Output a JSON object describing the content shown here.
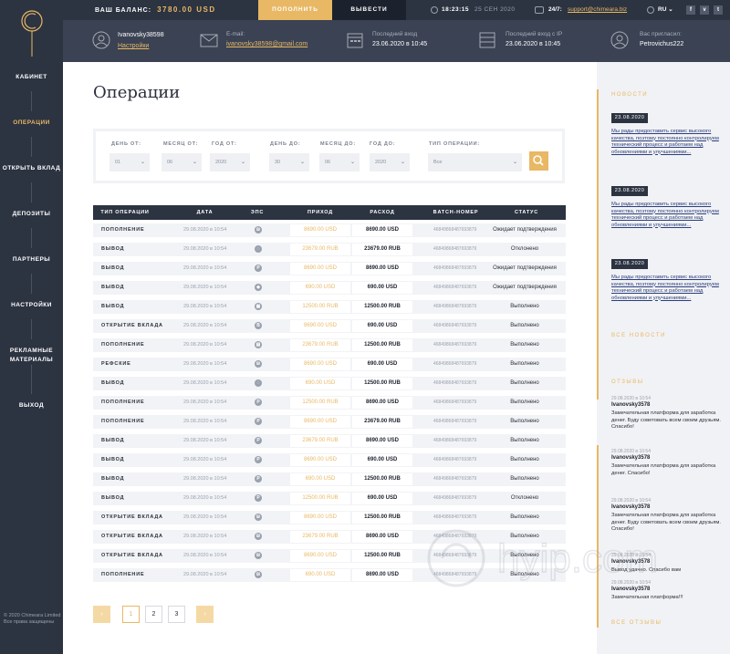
{
  "topbar": {
    "balance_label": "ВАШ БАЛАНС:",
    "balance_value": "3780.00 USD",
    "deposit_label": "ПОПОЛНИТЬ",
    "withdraw_label": "ВЫВЕСТИ",
    "time": "18:23:15",
    "date": "25 СЕН 2020",
    "support_label": "24/7:",
    "support_email": "support@chimeara.biz",
    "lang": "RU ⌄",
    "social": [
      "f",
      "v",
      "t"
    ]
  },
  "info": {
    "username": "Ivanovsky38598",
    "settings_link": "Настройки",
    "email_label": "E-mail:",
    "email_value": "ivanovsky38598@gmail.com",
    "last_login_label": "Последний вход",
    "last_login_value": "23.06.2020 в 10:45",
    "last_ip_label": "Последний вход с IP",
    "last_ip_value": "23.06.2020 в 10:45",
    "invited_label": "Вас пригласил:",
    "invited_value": "Petrovichus222"
  },
  "sidebar": {
    "items": [
      {
        "label": "КАБИНЕТ"
      },
      {
        "label": "ОПЕРАЦИИ"
      },
      {
        "label": "ОТКРЫТЬ ВКЛАД"
      },
      {
        "label": "ДЕПОЗИТЫ"
      },
      {
        "label": "ПАРТНЕРЫ"
      },
      {
        "label": "НАСТРОЙКИ"
      },
      {
        "label": "РЕКЛАМНЫЕ МАТЕРИАЛЫ"
      },
      {
        "label": "ВЫХОД"
      }
    ],
    "copyright_1": "© 2020 Chimeara Limited",
    "copyright_2": "Все права защищены"
  },
  "main": {
    "title": "Операции",
    "filters": {
      "day_from_label": "ДЕНЬ ОТ:",
      "day_from": "01",
      "month_from_label": "МЕСЯЦ ОТ:",
      "month_from": "06",
      "year_from_label": "ГОД ОТ:",
      "year_from": "2020",
      "day_to_label": "ДЕНЬ ДО:",
      "day_to": "30",
      "month_to_label": "МЕСЯЦ ДО:",
      "month_to": "06",
      "year_to_label": "ГОД ДО:",
      "year_to": "2020",
      "type_label": "ТИП ОПЕРАЦИИ:",
      "type": "Все"
    },
    "table": {
      "headers": [
        "ТИП ОПЕРАЦИИ",
        "ДАТА",
        "ЭПС",
        "ПРИХОД",
        "РАСХОД",
        "BATCH-НОМЕР",
        "СТАТУС"
      ],
      "rows": [
        {
          "type": "ПОПОЛНЕНИЕ",
          "date": "29.08.2020 в 10:54",
          "eps": "₪",
          "in": "8690.00 USD",
          "out": "8690.00 USD",
          "batch": "46849868487693879",
          "status": "Ожидает подтверждения"
        },
        {
          "type": "ВЫВОД",
          "date": "29.08.2020 в 10:54",
          "eps": "◌",
          "in": "23679.00 RUB",
          "out": "23679.00 RUB",
          "batch": "46849868487693879",
          "status": "Отклонено"
        },
        {
          "type": "ВЫВОД",
          "date": "29.08.2020 в 10:54",
          "eps": "P",
          "in": "8690.00 USD",
          "out": "8690.00 USD",
          "batch": "46849868487693879",
          "status": "Ожидает подтверждения"
        },
        {
          "type": "ВЫВОД",
          "date": "29.08.2020 в 10:54",
          "eps": "◆",
          "in": "690.00 USD",
          "out": "690.00 USD",
          "batch": "46849868487693879",
          "status": "Ожидает подтверждения"
        },
        {
          "type": "ВЫВОД",
          "date": "29.08.2020 в 10:54",
          "eps": "▣",
          "in": "12500.00 RUB",
          "out": "12500.00 RUB",
          "batch": "46849868487693879",
          "status": "Выполнено"
        },
        {
          "type": "ОТКРЫТИЕ ВКЛАДА",
          "date": "29.08.2020 в 10:54",
          "eps": "B",
          "in": "8690.00 USD",
          "out": "690.00 USD",
          "batch": "46849868487693879",
          "status": "Выполнено"
        },
        {
          "type": "ПОПОЛНЕНИЕ",
          "date": "29.08.2020 в 10:54",
          "eps": "▤",
          "in": "23679.00 RUB",
          "out": "12500.00 RUB",
          "batch": "46849868487693879",
          "status": "Выполнено"
        },
        {
          "type": "РЕФСКИЕ",
          "date": "29.08.2020 в 10:54",
          "eps": "₪",
          "in": "8690.00 USD",
          "out": "690.00 USD",
          "batch": "46849868487693879",
          "status": "Выполнено"
        },
        {
          "type": "ВЫВОД",
          "date": "29.08.2020 в 10:54",
          "eps": "◌",
          "in": "690.00 USD",
          "out": "12500.00 RUB",
          "batch": "46849868487693879",
          "status": "Выполнено"
        },
        {
          "type": "ПОПОЛНЕНИЕ",
          "date": "29.08.2020 в 10:54",
          "eps": "P",
          "in": "12500.00 RUB",
          "out": "8690.00 USD",
          "batch": "46849868487693879",
          "status": "Выполнено"
        },
        {
          "type": "ПОПОЛНЕНИЕ",
          "date": "29.08.2020 в 10:54",
          "eps": "P",
          "in": "8690.00 USD",
          "out": "23679.00 RUB",
          "batch": "46849868487693879",
          "status": "Выполнено"
        },
        {
          "type": "ВЫВОД",
          "date": "29.08.2020 в 10:54",
          "eps": "P",
          "in": "23679.00 RUB",
          "out": "8690.00 USD",
          "batch": "46849868487693879",
          "status": "Выполнено"
        },
        {
          "type": "ВЫВОД",
          "date": "29.08.2020 в 10:54",
          "eps": "P",
          "in": "8690.00 USD",
          "out": "690.00 USD",
          "batch": "46849868487693879",
          "status": "Выполнено"
        },
        {
          "type": "ВЫВОД",
          "date": "29.08.2020 в 10:54",
          "eps": "P",
          "in": "690.00 USD",
          "out": "12500.00 RUB",
          "batch": "46849868487693879",
          "status": "Выполнено"
        },
        {
          "type": "ВЫВОД",
          "date": "29.08.2020 в 10:54",
          "eps": "P",
          "in": "12500.00 RUB",
          "out": "690.00 USD",
          "batch": "46849868487693879",
          "status": "Отклонено"
        },
        {
          "type": "ОТКРЫТИЕ ВКЛАДА",
          "date": "29.08.2020 в 10:54",
          "eps": "₪",
          "in": "8690.00 USD",
          "out": "12500.00 RUB",
          "batch": "46849868487693879",
          "status": "Выполнено"
        },
        {
          "type": "ОТКРЫТИЕ ВКЛАДА",
          "date": "29.08.2020 в 10:54",
          "eps": "₪",
          "in": "23679.00 RUB",
          "out": "8690.00 USD",
          "batch": "46849868487693879",
          "status": "Выполнено"
        },
        {
          "type": "ОТКРЫТИЕ ВКЛАДА",
          "date": "29.08.2020 в 10:54",
          "eps": "₪",
          "in": "8690.00 USD",
          "out": "12500.00 RUB",
          "batch": "46849868487693879",
          "status": "Выполнено"
        },
        {
          "type": "ПОПОЛНЕНИЕ",
          "date": "29.08.2020 в 10:54",
          "eps": "₪",
          "in": "690.00 USD",
          "out": "8690.00 USD",
          "batch": "46849868487693879",
          "status": "Выполнено"
        }
      ]
    },
    "pagination": {
      "prev": "‹",
      "pages": [
        "1",
        "2",
        "3"
      ],
      "next": "›"
    }
  },
  "right": {
    "news_title": "НОВОСТИ",
    "news": [
      {
        "date": "23.08.2020",
        "text": "Мы рады предоставить сервис высокого качества, поэтому постоянно контролируем технический процесс и работаем над обновлениями и улучшениями..."
      },
      {
        "date": "23.08.2020",
        "text": "Мы рады предоставить сервис высокого качества, поэтому постоянно контролируем технический процесс и работаем над обновлениями и улучшениями..."
      },
      {
        "date": "23.08.2020",
        "text": "Мы рады предоставить сервис высокого качества, поэтому постоянно контролируем технический процесс и работаем над обновлениями и улучшениями..."
      }
    ],
    "all_news": "ВСЕ НОВОСТИ",
    "reviews_title": "ОТЗЫВЫ",
    "reviews": [
      {
        "date": "29.08.2020 в 10:54",
        "name": "Ivanovsky3578",
        "text": "Замечательная платформа для заработка денег. Буду советовать всем своим друзьям. Спасибо!"
      },
      {
        "date": "29.08.2020 в 10:54",
        "name": "Ivanovsky3578",
        "text": "Замечательная платформа для заработка денег. Спасибо!"
      },
      {
        "date": "29.08.2020 в 10:54",
        "name": "Ivanovsky3578",
        "text": "Замечательная платформа для заработка денег. Буду советовать всем своим друзьям. Спасибо!"
      },
      {
        "date": "29.08.2020 в 10:54",
        "name": "Ivanovsky3578",
        "text": "Вывод удачно. Спасибо вам"
      },
      {
        "date": "29.08.2020 в 10:54",
        "name": "Ivanovsky3578",
        "text": "Замечательная платформа!!!"
      }
    ],
    "all_reviews": "ВСЕ ОТЗЫВЫ"
  },
  "watermark_text": "hyip.com",
  "colors": {
    "accent": "#e8b865",
    "dark": "#2c3341",
    "info": "#3a4253"
  }
}
